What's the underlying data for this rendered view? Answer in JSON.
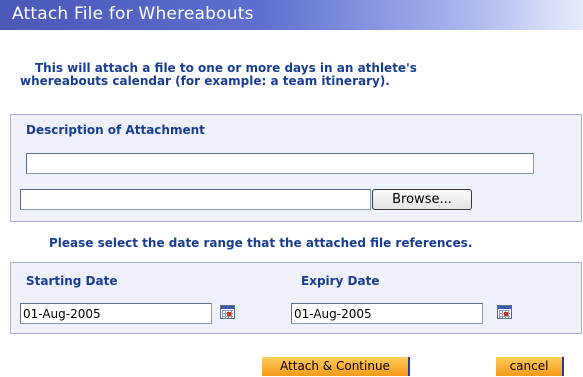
{
  "window": {
    "title": "Attach File for Whereabouts"
  },
  "intro": {
    "line1": "This will attach a file to one or more days in an athlete's",
    "line2": "whereabouts calendar (for example: a team itinerary)."
  },
  "description_section": {
    "label": "Description of Attachment",
    "description_value": "",
    "file_path_value": "",
    "browse_label": "Browse..."
  },
  "date_range_note": "Please select the date range that the attached file references.",
  "dates": {
    "starting_label": "Starting Date",
    "starting_value": "01-Aug-2005",
    "expiry_label": "Expiry Date",
    "expiry_value": "01-Aug-2005"
  },
  "actions": {
    "attach_label": "Attach & Continue",
    "cancel_label": "cancel"
  },
  "colors": {
    "title_bar": "#4a58b8",
    "label_text": "#1a3d94",
    "panel_bg": "#eef1fa",
    "button_orange": "#f59a17"
  },
  "icons": {
    "calendar": "calendar-icon"
  }
}
